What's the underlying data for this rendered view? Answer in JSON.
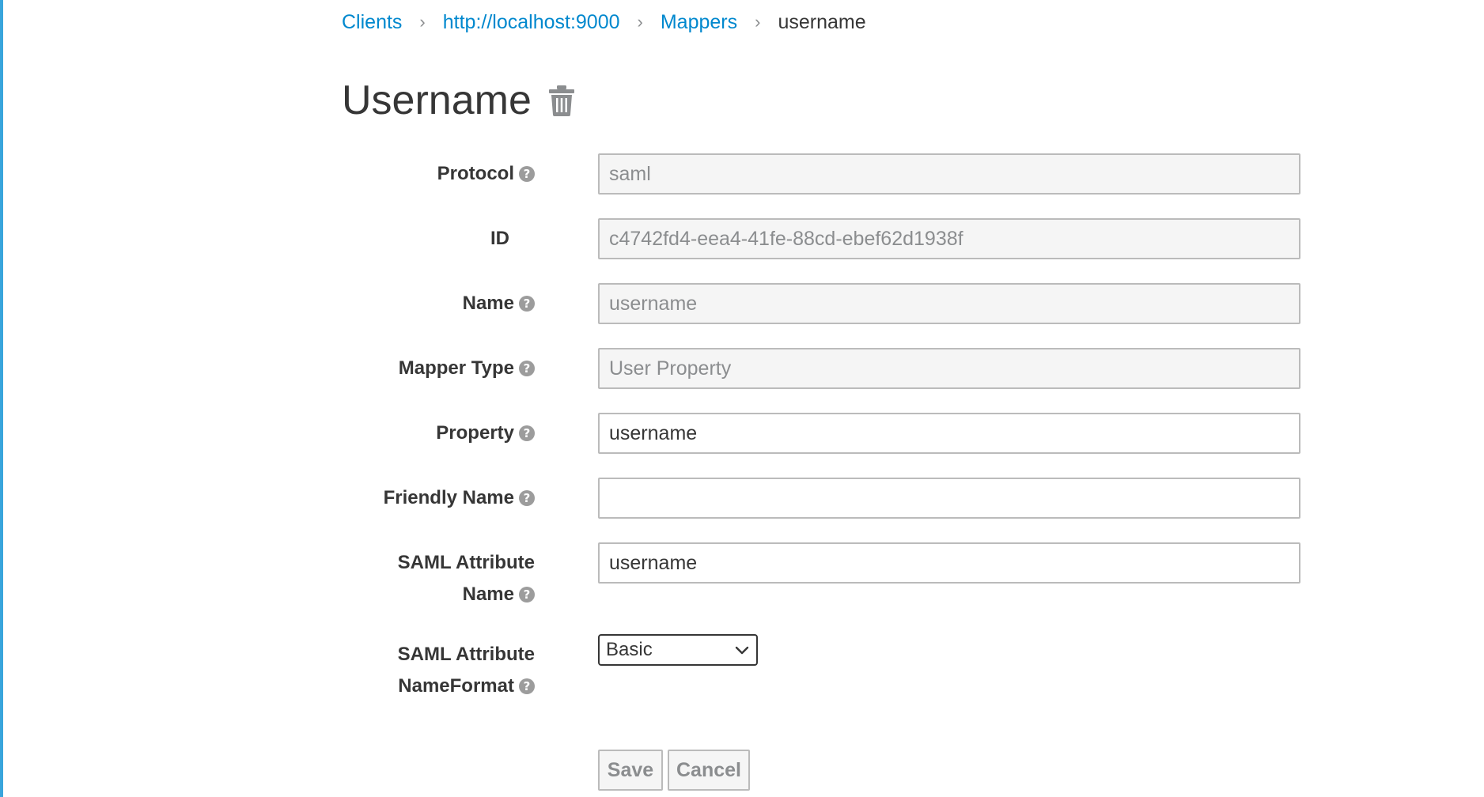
{
  "breadcrumb": {
    "items": [
      "Clients",
      "http://localhost:9000",
      "Mappers"
    ],
    "current": "username",
    "separator": "›"
  },
  "title": "Username",
  "form": {
    "protocol": {
      "label": "Protocol",
      "value": "saml"
    },
    "id": {
      "label": "ID",
      "value": "c4742fd4-eea4-41fe-88cd-ebef62d1938f"
    },
    "name": {
      "label": "Name",
      "value": "username"
    },
    "mapper_type": {
      "label": "Mapper Type",
      "value": "User Property"
    },
    "property": {
      "label": "Property",
      "value": "username"
    },
    "friendly_name": {
      "label": "Friendly Name",
      "value": ""
    },
    "saml_attribute_name": {
      "label_line1": "SAML Attribute",
      "label_line2": "Name",
      "value": "username"
    },
    "saml_attribute_nameformat": {
      "label_line1": "SAML Attribute",
      "label_line2": "NameFormat",
      "value": "Basic"
    }
  },
  "buttons": {
    "save": "Save",
    "cancel": "Cancel"
  },
  "help_glyph": "?",
  "icons": {
    "delete": "trash-icon",
    "help": "question-circle-icon",
    "select": "chevron-down-icon"
  }
}
